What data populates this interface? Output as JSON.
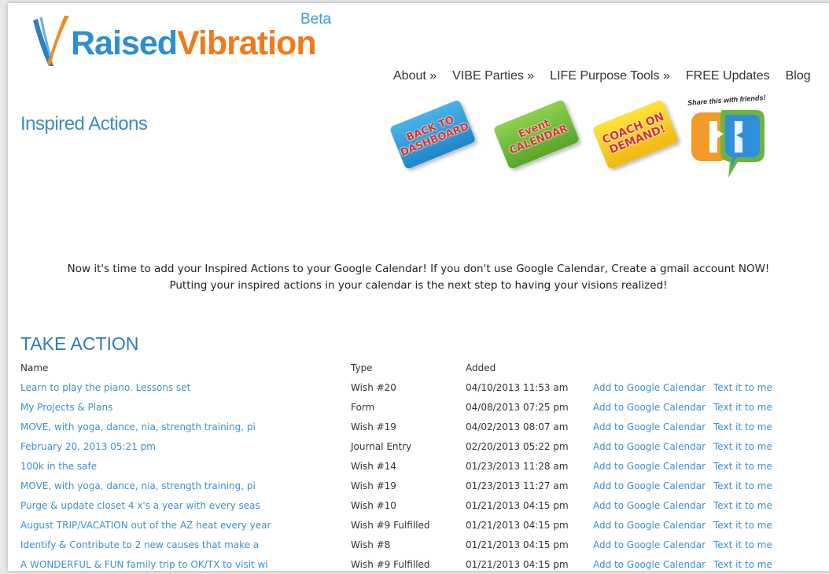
{
  "logo": {
    "part1": "Raised",
    "part2": "Vibration",
    "beta": "Beta"
  },
  "nav": {
    "items": [
      {
        "label": "About »"
      },
      {
        "label": "VIBE Parties »"
      },
      {
        "label": "LIFE Purpose Tools »"
      },
      {
        "label": "FREE Updates"
      },
      {
        "label": "Blog"
      }
    ]
  },
  "page_title": "Inspired Actions",
  "badges": {
    "dashboard": {
      "line1": "BACK TO",
      "line2": "DASHBOARD"
    },
    "calendar": {
      "line1": "Event",
      "line2": "CALENDAR"
    },
    "coach": {
      "line1": "COACH ON",
      "line2": "DEMAND!"
    },
    "share": {
      "label": "Share this with friends!"
    }
  },
  "intro": {
    "line1": "Now it's time to add your Inspired Actions to your Google Calendar! If you don't use Google Calendar, Create a gmail account NOW!",
    "line2": "Putting your inspired actions in your calendar is the next step to having your visions realized!"
  },
  "section_title": "TAKE ACTION",
  "table": {
    "headers": {
      "name": "Name",
      "type": "Type",
      "added": "Added"
    },
    "action_gcal": "Add to Google Calendar",
    "action_text": "Text it to me",
    "rows": [
      {
        "name": "Learn to play the piano. Lessons set",
        "type": "Wish #20",
        "added": "04/10/2013 11:53 am"
      },
      {
        "name": "My Projects & Plans",
        "type": "Form",
        "added": "04/08/2013 07:25 pm"
      },
      {
        "name": "MOVE, with yoga, dance, nia, strength training, pi",
        "type": "Wish #19",
        "added": "04/02/2013 08:07 am"
      },
      {
        "name": "February 20, 2013 05:21 pm",
        "type": "Journal Entry",
        "added": "02/20/2013 05:22 pm"
      },
      {
        "name": "100k in the safe",
        "type": "Wish #14",
        "added": "01/23/2013 11:28 am"
      },
      {
        "name": "MOVE, with yoga, dance, nia, strength training, pi",
        "type": "Wish #19",
        "added": "01/23/2013 11:27 am"
      },
      {
        "name": "Purge & update closet 4 x's a year with every seas",
        "type": "Wish #10",
        "added": "01/21/2013 04:15 pm"
      },
      {
        "name": "August TRIP/VACATION out of the AZ heat every year",
        "type": "Wish #9 Fulfilled",
        "added": "01/21/2013 04:15 pm"
      },
      {
        "name": "Identify & Contribute to 2 new causes that make a",
        "type": "Wish #8",
        "added": "01/21/2013 04:15 pm"
      },
      {
        "name": "A WONDERFUL & FUN family trip to OK/TX to visit wi",
        "type": "Wish #9 Fulfilled",
        "added": "01/21/2013 04:15 pm"
      }
    ]
  }
}
